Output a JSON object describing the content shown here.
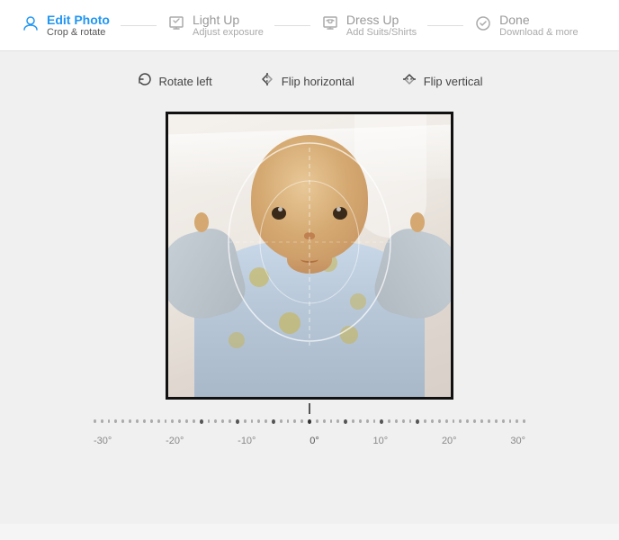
{
  "header": {
    "steps": [
      {
        "id": "edit-photo",
        "title": "Edit Photo",
        "subtitle": "Crop & rotate",
        "active": true,
        "icon": "person"
      },
      {
        "id": "light-up",
        "title": "Light Up",
        "subtitle": "Adjust exposure",
        "active": false,
        "icon": "sun"
      },
      {
        "id": "dress-up",
        "title": "Dress Up",
        "subtitle": "Add Suits/Shirts",
        "active": false,
        "icon": "shirt"
      },
      {
        "id": "done",
        "title": "Done",
        "subtitle": "Download & more",
        "active": false,
        "icon": "check"
      }
    ]
  },
  "toolbar": {
    "rotate_left": "Rotate left",
    "flip_horizontal": "Flip horizontal",
    "flip_vertical": "Flip vertical"
  },
  "slider": {
    "labels": [
      "-30°",
      "-20°",
      "-10°",
      "0°",
      "10°",
      "20°",
      "30°"
    ]
  }
}
